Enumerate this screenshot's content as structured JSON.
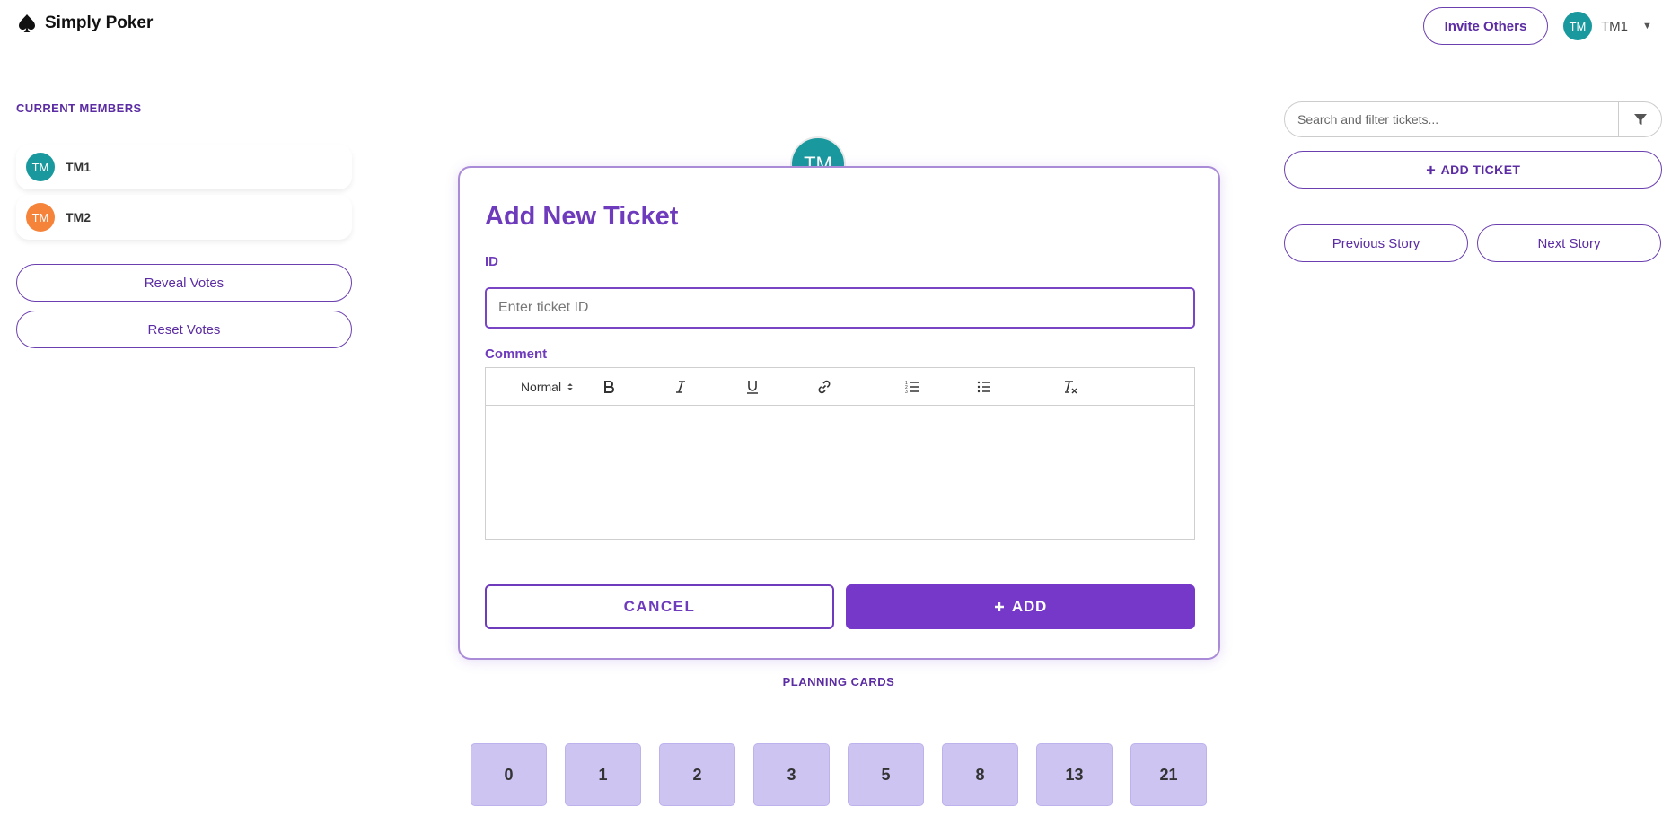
{
  "app": {
    "name": "Simply Poker",
    "logo_icon": "spade-icon"
  },
  "header": {
    "invite_label": "Invite Others",
    "user": {
      "initials": "TM",
      "name": "TM1",
      "avatar_color": "#19999e"
    }
  },
  "members": {
    "title": "CURRENT MEMBERS",
    "items": [
      {
        "initials": "TM",
        "name": "TM1",
        "color": "#19999e"
      },
      {
        "initials": "TM",
        "name": "TM2",
        "color": "#f5843a"
      }
    ],
    "reveal_label": "Reveal Votes",
    "reset_label": "Reset Votes"
  },
  "table": {
    "avatar_initials": "TM"
  },
  "modal": {
    "title": "Add New Ticket",
    "id_label": "ID",
    "id_value": "",
    "id_placeholder": "Enter ticket ID",
    "comment_label": "Comment",
    "toolbar": {
      "format_select": "Normal",
      "buttons": [
        "bold-icon",
        "italic-icon",
        "underline-icon",
        "link-icon",
        "ordered-list-icon",
        "bullet-list-icon",
        "clear-format-icon"
      ]
    },
    "cancel_label": "CANCEL",
    "add_label": "ADD",
    "add_icon": "plus-icon"
  },
  "planning": {
    "title": "PLANNING CARDS",
    "cards": [
      "0",
      "1",
      "2",
      "3",
      "5",
      "8",
      "13",
      "21"
    ]
  },
  "tickets": {
    "search_placeholder": "Search and filter tickets...",
    "search_value": "",
    "add_ticket_label": "ADD TICKET",
    "previous_label": "Previous Story",
    "next_label": "Next Story"
  },
  "colors": {
    "brand_purple": "#6f3bbd",
    "button_purple": "#7638c8",
    "card_lavender": "#cdc4f2"
  }
}
